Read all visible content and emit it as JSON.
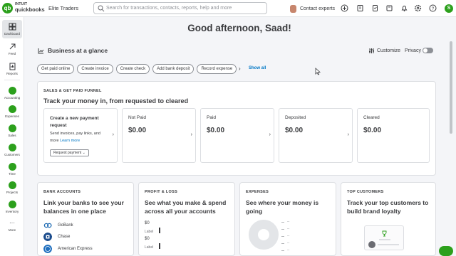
{
  "topbar": {
    "logo_badge": "qb",
    "logo_intuit": "INTUIT",
    "logo_name": "quickbooks",
    "company": "Elite Traders",
    "search_placeholder": "Search for transactions, contacts, reports, help and more",
    "contact_experts": "Contact experts",
    "user_initial": "S",
    "icons": [
      "plus-icon",
      "bell-icon",
      "edit-icon",
      "settings-icon",
      "help-icon"
    ]
  },
  "rail": {
    "items": [
      {
        "label": "Dashboard",
        "icon": "grid-icon"
      },
      {
        "label": "Feed",
        "icon": "feed-icon"
      },
      {
        "label": "Reports",
        "icon": "reports-icon"
      },
      {
        "label": "Accounting",
        "icon": "accounting-icon"
      },
      {
        "label": "Expenses",
        "icon": "expenses-icon"
      },
      {
        "label": "Sales",
        "icon": "sales-icon"
      },
      {
        "label": "Customers",
        "icon": "customers-icon"
      },
      {
        "label": "Time",
        "icon": "time-icon"
      },
      {
        "label": "Projects",
        "icon": "projects-icon"
      },
      {
        "label": "Inventory",
        "icon": "inventory-icon"
      },
      {
        "label": "More",
        "icon": "more-icon",
        "glyph": "···"
      }
    ]
  },
  "main": {
    "greeting": "Good afternoon, Saad!",
    "business_glance": "Business at a glance",
    "customize": "Customize",
    "privacy": "Privacy",
    "chips": [
      "Get paid online",
      "Create invoice",
      "Create check",
      "Add bank deposit",
      "Record expense"
    ],
    "show_all": "Show all",
    "chevron": "›"
  },
  "funnel": {
    "heading": "SALES & GET PAID FUNNEL",
    "title": "Track your money in, from requested to cleared",
    "payment_title": "Create a new payment request",
    "payment_desc": "Send invoices, pay links, and more",
    "learn_more": "Learn more",
    "request_button": "Request payment",
    "request_caret": "⌄",
    "stages": [
      {
        "label": "Not Paid",
        "amount": "$0.00"
      },
      {
        "label": "Paid",
        "amount": "$0.00"
      },
      {
        "label": "Deposited",
        "amount": "$0.00"
      },
      {
        "label": "Cleared",
        "amount": "$0.00"
      }
    ],
    "arrow": "›"
  },
  "bank_accounts": {
    "heading": "BANK ACCOUNTS",
    "title": "Link your banks to see your balances in one place",
    "banks": [
      {
        "name": "GoBank",
        "color": "#1d6ab3"
      },
      {
        "name": "Chase",
        "color": "#1a4b8c"
      },
      {
        "name": "American Express",
        "color": "#1f6fbf"
      }
    ],
    "add_glyph": "+"
  },
  "profit_loss": {
    "heading": "PROFIT & LOSS",
    "title": "See what you make & spend across all your accounts",
    "rows": [
      {
        "amount": "$0",
        "label": "Label"
      },
      {
        "amount": "$0",
        "label": "Label"
      }
    ]
  },
  "expenses": {
    "heading": "EXPENSES",
    "title": "See where your money is going",
    "legend": [
      "--",
      "--",
      "--",
      "--",
      "--",
      "--"
    ]
  },
  "top_customers": {
    "heading": "TOP CUSTOMERS",
    "title": "Track your top customers to build brand loyalty"
  },
  "colors": {
    "brand_green": "#2ca01c",
    "link_blue": "#0077c5",
    "text": "#393a3d"
  }
}
